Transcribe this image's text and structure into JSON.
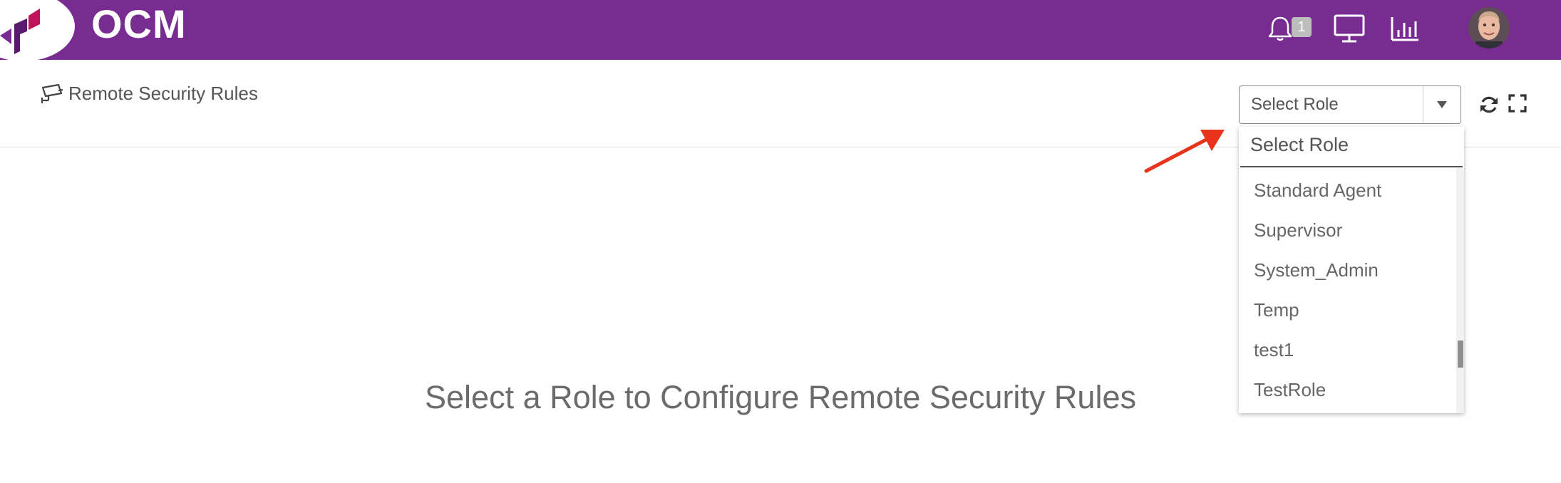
{
  "app": {
    "title": "OCM"
  },
  "header": {
    "notifications_count": "1",
    "icons": [
      "bell-icon",
      "monitor-icon",
      "bar-chart-icon",
      "avatar"
    ]
  },
  "page": {
    "title": "Remote Security Rules",
    "title_icon": "security-camera-icon"
  },
  "role_select": {
    "value": "Select Role",
    "dropdown": {
      "placeholder": "Select Role",
      "options": [
        "Standard Agent",
        "Supervisor",
        "System_Admin",
        "Temp",
        "test1",
        "TestRole"
      ]
    }
  },
  "toolbar": {
    "icons": [
      "refresh-icon",
      "fullscreen-icon"
    ]
  },
  "main": {
    "empty_message": "Select a Role to Configure Remote Security Rules"
  },
  "colors": {
    "brand": "#782b90",
    "annotation_arrow": "#e8341c"
  }
}
